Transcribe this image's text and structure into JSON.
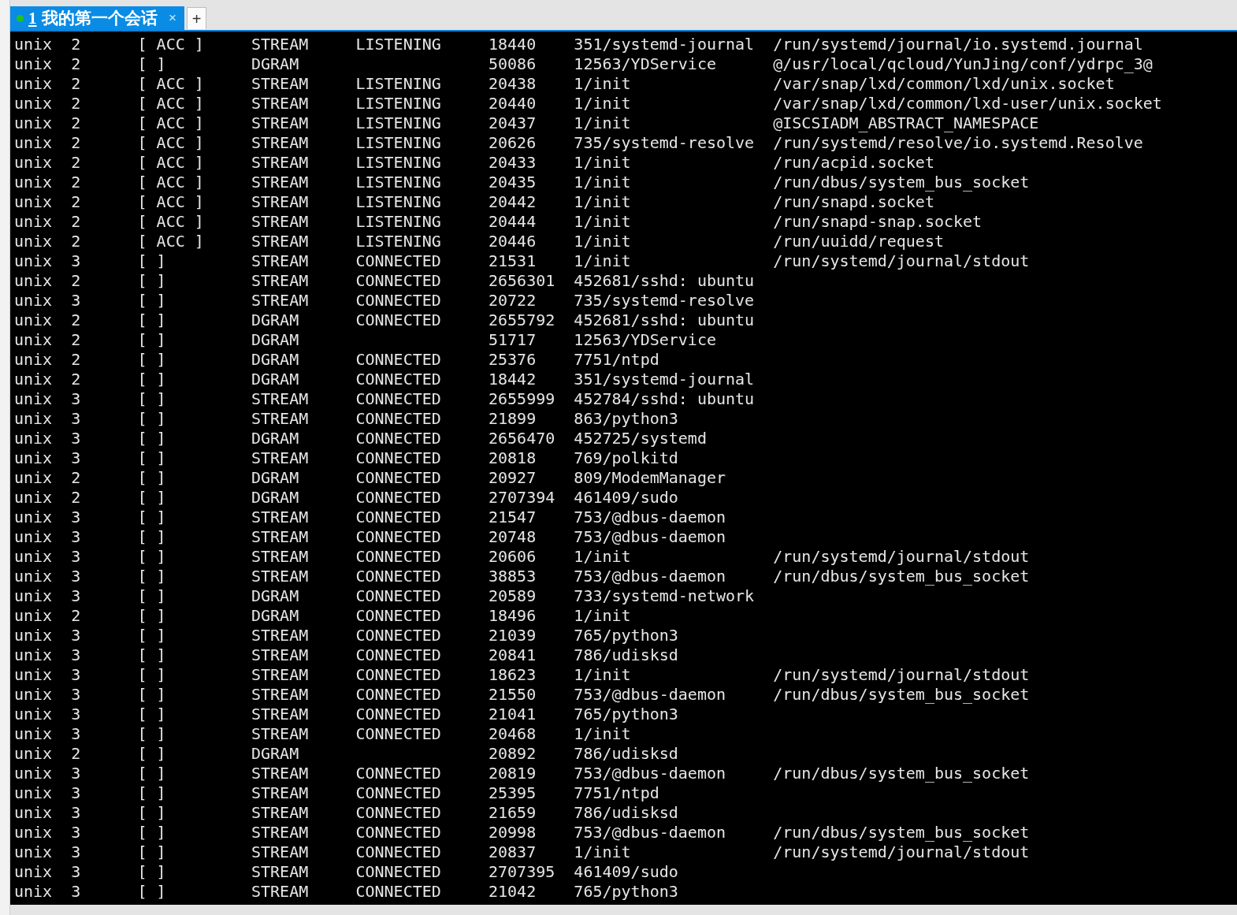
{
  "tabs": [
    {
      "number": "1",
      "title": "我的第一个会话",
      "close": "×",
      "selected": true,
      "connected": true
    }
  ],
  "new_tab_button": "+",
  "terminal": {
    "rows": [
      {
        "column_1": "unix",
        "column_2": "2",
        "column_3": "[ ACC ]",
        "column_4": "STREAM",
        "column_5": "LISTENING",
        "column_6": "18440",
        "column_7": "351/systemd-journal",
        "column_8": "/run/systemd/journal/io.systemd.journal"
      },
      {
        "column_1": "unix",
        "column_2": "2",
        "column_3": "[ ]",
        "column_4": "DGRAM",
        "column_6": "50086",
        "column_7": "12563/YDService",
        "column_8": "@/usr/local/qcloud/YunJing/conf/ydrpc_3@"
      },
      {
        "column_1": "unix",
        "column_2": "2",
        "column_3": "[ ACC ]",
        "column_4": "STREAM",
        "column_5": "LISTENING",
        "column_6": "20438",
        "column_7": "1/init",
        "column_8": "/var/snap/lxd/common/lxd/unix.socket"
      },
      {
        "column_1": "unix",
        "column_2": "2",
        "column_3": "[ ACC ]",
        "column_4": "STREAM",
        "column_5": "LISTENING",
        "column_6": "20440",
        "column_7": "1/init",
        "column_8": "/var/snap/lxd/common/lxd-user/unix.socket"
      },
      {
        "column_1": "unix",
        "column_2": "2",
        "column_3": "[ ACC ]",
        "column_4": "STREAM",
        "column_5": "LISTENING",
        "column_6": "20437",
        "column_7": "1/init",
        "column_8": "@ISCSIADM_ABSTRACT_NAMESPACE"
      },
      {
        "column_1": "unix",
        "column_2": "2",
        "column_3": "[ ACC ]",
        "column_4": "STREAM",
        "column_5": "LISTENING",
        "column_6": "20626",
        "column_7": "735/systemd-resolve",
        "column_8": "/run/systemd/resolve/io.systemd.Resolve"
      },
      {
        "column_1": "unix",
        "column_2": "2",
        "column_3": "[ ACC ]",
        "column_4": "STREAM",
        "column_5": "LISTENING",
        "column_6": "20433",
        "column_7": "1/init",
        "column_8": "/run/acpid.socket"
      },
      {
        "column_1": "unix",
        "column_2": "2",
        "column_3": "[ ACC ]",
        "column_4": "STREAM",
        "column_5": "LISTENING",
        "column_6": "20435",
        "column_7": "1/init",
        "column_8": "/run/dbus/system_bus_socket"
      },
      {
        "column_1": "unix",
        "column_2": "2",
        "column_3": "[ ACC ]",
        "column_4": "STREAM",
        "column_5": "LISTENING",
        "column_6": "20442",
        "column_7": "1/init",
        "column_8": "/run/snapd.socket"
      },
      {
        "column_1": "unix",
        "column_2": "2",
        "column_3": "[ ACC ]",
        "column_4": "STREAM",
        "column_5": "LISTENING",
        "column_6": "20444",
        "column_7": "1/init",
        "column_8": "/run/snapd-snap.socket"
      },
      {
        "column_1": "unix",
        "column_2": "2",
        "column_3": "[ ACC ]",
        "column_4": "STREAM",
        "column_5": "LISTENING",
        "column_6": "20446",
        "column_7": "1/init",
        "column_8": "/run/uuidd/request"
      },
      {
        "column_1": "unix",
        "column_2": "3",
        "column_3": "[ ]",
        "column_4": "STREAM",
        "column_5": "CONNECTED",
        "column_6": "21531",
        "column_7": "1/init",
        "column_8": "/run/systemd/journal/stdout"
      },
      {
        "column_1": "unix",
        "column_2": "2",
        "column_3": "[ ]",
        "column_4": "STREAM",
        "column_5": "CONNECTED",
        "column_6": "2656301",
        "column_7": "452681/sshd: ubuntu"
      },
      {
        "column_1": "unix",
        "column_2": "3",
        "column_3": "[ ]",
        "column_4": "STREAM",
        "column_5": "CONNECTED",
        "column_6": "20722",
        "column_7": "735/systemd-resolve"
      },
      {
        "column_1": "unix",
        "column_2": "2",
        "column_3": "[ ]",
        "column_4": "DGRAM",
        "column_5": "CONNECTED",
        "column_6": "2655792",
        "column_7": "452681/sshd: ubuntu"
      },
      {
        "column_1": "unix",
        "column_2": "2",
        "column_3": "[ ]",
        "column_4": "DGRAM",
        "column_6": "51717",
        "column_7": "12563/YDService"
      },
      {
        "column_1": "unix",
        "column_2": "2",
        "column_3": "[ ]",
        "column_4": "DGRAM",
        "column_5": "CONNECTED",
        "column_6": "25376",
        "column_7": "7751/ntpd"
      },
      {
        "column_1": "unix",
        "column_2": "2",
        "column_3": "[ ]",
        "column_4": "DGRAM",
        "column_5": "CONNECTED",
        "column_6": "18442",
        "column_7": "351/systemd-journal"
      },
      {
        "column_1": "unix",
        "column_2": "3",
        "column_3": "[ ]",
        "column_4": "STREAM",
        "column_5": "CONNECTED",
        "column_6": "2655999",
        "column_7": "452784/sshd: ubuntu"
      },
      {
        "column_1": "unix",
        "column_2": "3",
        "column_3": "[ ]",
        "column_4": "STREAM",
        "column_5": "CONNECTED",
        "column_6": "21899",
        "column_7": "863/python3"
      },
      {
        "column_1": "unix",
        "column_2": "3",
        "column_3": "[ ]",
        "column_4": "DGRAM",
        "column_5": "CONNECTED",
        "column_6": "2656470",
        "column_7": "452725/systemd"
      },
      {
        "column_1": "unix",
        "column_2": "3",
        "column_3": "[ ]",
        "column_4": "STREAM",
        "column_5": "CONNECTED",
        "column_6": "20818",
        "column_7": "769/polkitd"
      },
      {
        "column_1": "unix",
        "column_2": "2",
        "column_3": "[ ]",
        "column_4": "DGRAM",
        "column_5": "CONNECTED",
        "column_6": "20927",
        "column_7": "809/ModemManager"
      },
      {
        "column_1": "unix",
        "column_2": "2",
        "column_3": "[ ]",
        "column_4": "DGRAM",
        "column_5": "CONNECTED",
        "column_6": "2707394",
        "column_7": "461409/sudo"
      },
      {
        "column_1": "unix",
        "column_2": "3",
        "column_3": "[ ]",
        "column_4": "STREAM",
        "column_5": "CONNECTED",
        "column_6": "21547",
        "column_7": "753/@dbus-daemon"
      },
      {
        "column_1": "unix",
        "column_2": "3",
        "column_3": "[ ]",
        "column_4": "STREAM",
        "column_5": "CONNECTED",
        "column_6": "20748",
        "column_7": "753/@dbus-daemon"
      },
      {
        "column_1": "unix",
        "column_2": "3",
        "column_3": "[ ]",
        "column_4": "STREAM",
        "column_5": "CONNECTED",
        "column_6": "20606",
        "column_7": "1/init",
        "column_8": "/run/systemd/journal/stdout"
      },
      {
        "column_1": "unix",
        "column_2": "3",
        "column_3": "[ ]",
        "column_4": "STREAM",
        "column_5": "CONNECTED",
        "column_6": "38853",
        "column_7": "753/@dbus-daemon",
        "column_8": "/run/dbus/system_bus_socket"
      },
      {
        "column_1": "unix",
        "column_2": "3",
        "column_3": "[ ]",
        "column_4": "DGRAM",
        "column_5": "CONNECTED",
        "column_6": "20589",
        "column_7": "733/systemd-network"
      },
      {
        "column_1": "unix",
        "column_2": "2",
        "column_3": "[ ]",
        "column_4": "DGRAM",
        "column_5": "CONNECTED",
        "column_6": "18496",
        "column_7": "1/init"
      },
      {
        "column_1": "unix",
        "column_2": "3",
        "column_3": "[ ]",
        "column_4": "STREAM",
        "column_5": "CONNECTED",
        "column_6": "21039",
        "column_7": "765/python3"
      },
      {
        "column_1": "unix",
        "column_2": "3",
        "column_3": "[ ]",
        "column_4": "STREAM",
        "column_5": "CONNECTED",
        "column_6": "20841",
        "column_7": "786/udisksd"
      },
      {
        "column_1": "unix",
        "column_2": "3",
        "column_3": "[ ]",
        "column_4": "STREAM",
        "column_5": "CONNECTED",
        "column_6": "18623",
        "column_7": "1/init",
        "column_8": "/run/systemd/journal/stdout"
      },
      {
        "column_1": "unix",
        "column_2": "3",
        "column_3": "[ ]",
        "column_4": "STREAM",
        "column_5": "CONNECTED",
        "column_6": "21550",
        "column_7": "753/@dbus-daemon",
        "column_8": "/run/dbus/system_bus_socket"
      },
      {
        "column_1": "unix",
        "column_2": "3",
        "column_3": "[ ]",
        "column_4": "STREAM",
        "column_5": "CONNECTED",
        "column_6": "21041",
        "column_7": "765/python3"
      },
      {
        "column_1": "unix",
        "column_2": "3",
        "column_3": "[ ]",
        "column_4": "STREAM",
        "column_5": "CONNECTED",
        "column_6": "20468",
        "column_7": "1/init"
      },
      {
        "column_1": "unix",
        "column_2": "2",
        "column_3": "[ ]",
        "column_4": "DGRAM",
        "column_6": "20892",
        "column_7": "786/udisksd"
      },
      {
        "column_1": "unix",
        "column_2": "3",
        "column_3": "[ ]",
        "column_4": "STREAM",
        "column_5": "CONNECTED",
        "column_6": "20819",
        "column_7": "753/@dbus-daemon",
        "column_8": "/run/dbus/system_bus_socket"
      },
      {
        "column_1": "unix",
        "column_2": "3",
        "column_3": "[ ]",
        "column_4": "STREAM",
        "column_5": "CONNECTED",
        "column_6": "25395",
        "column_7": "7751/ntpd"
      },
      {
        "column_1": "unix",
        "column_2": "3",
        "column_3": "[ ]",
        "column_4": "STREAM",
        "column_5": "CONNECTED",
        "column_6": "21659",
        "column_7": "786/udisksd"
      },
      {
        "column_1": "unix",
        "column_2": "3",
        "column_3": "[ ]",
        "column_4": "STREAM",
        "column_5": "CONNECTED",
        "column_6": "20998",
        "column_7": "753/@dbus-daemon",
        "column_8": "/run/dbus/system_bus_socket"
      },
      {
        "column_1": "unix",
        "column_2": "3",
        "column_3": "[ ]",
        "column_4": "STREAM",
        "column_5": "CONNECTED",
        "column_6": "20837",
        "column_7": "1/init",
        "column_8": "/run/systemd/journal/stdout"
      },
      {
        "column_1": "unix",
        "column_2": "3",
        "column_3": "[ ]",
        "column_4": "STREAM",
        "column_5": "CONNECTED",
        "column_6": "2707395",
        "column_7": "461409/sudo"
      },
      {
        "column_1": "unix",
        "column_2": "3",
        "column_3": "[ ]",
        "column_4": "STREAM",
        "column_5": "CONNECTED",
        "column_6": "21042",
        "column_7": "765/python3"
      }
    ]
  }
}
